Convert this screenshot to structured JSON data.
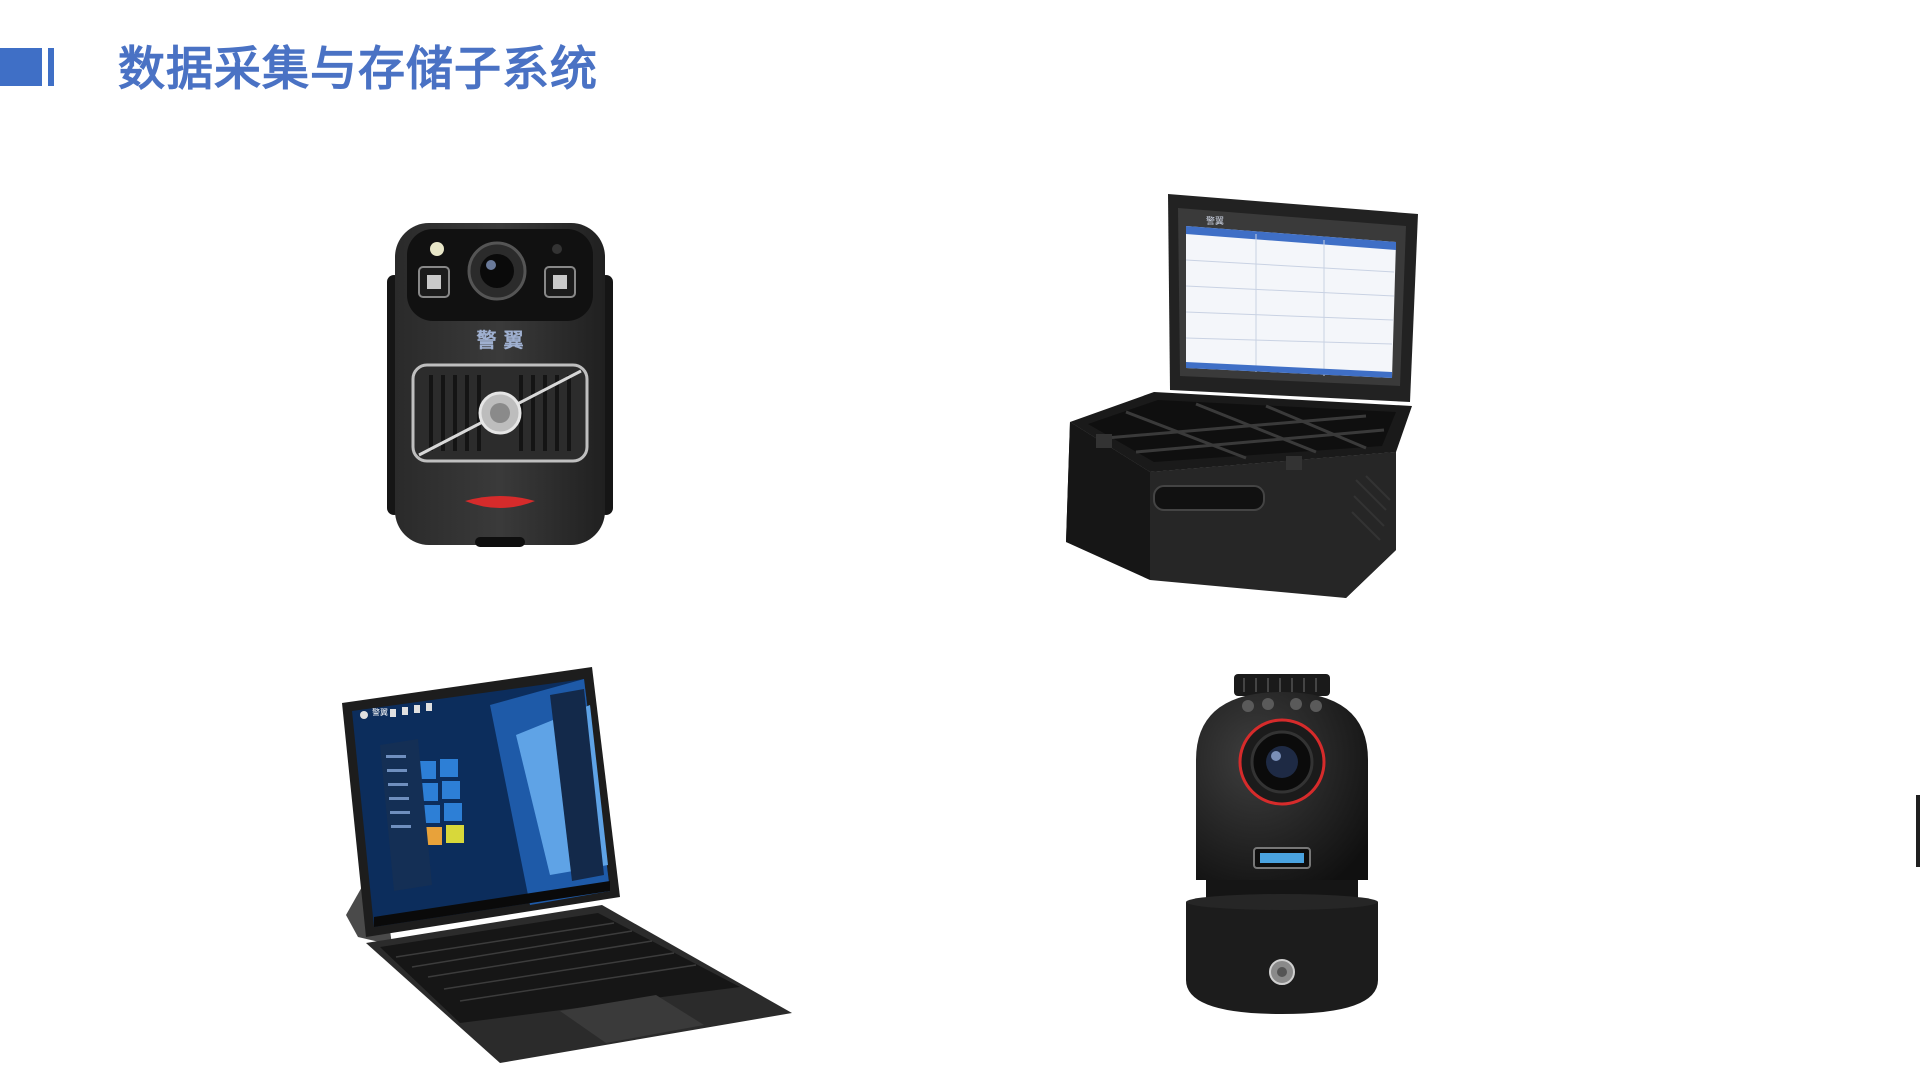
{
  "header": {
    "title": "数据采集与存储子系统"
  },
  "devices": [
    {
      "id": "body-camera",
      "brand_text": "警 翼"
    },
    {
      "id": "collection-workstation",
      "brand_text": "警翼"
    },
    {
      "id": "tablet-pc",
      "brand_text": "警翼"
    },
    {
      "id": "ptz-camera"
    }
  ],
  "colors": {
    "accent": "#3f6fc6",
    "title": "#4a72c4",
    "device_body": "#1c1c1c",
    "red_accent": "#d62b2b"
  }
}
